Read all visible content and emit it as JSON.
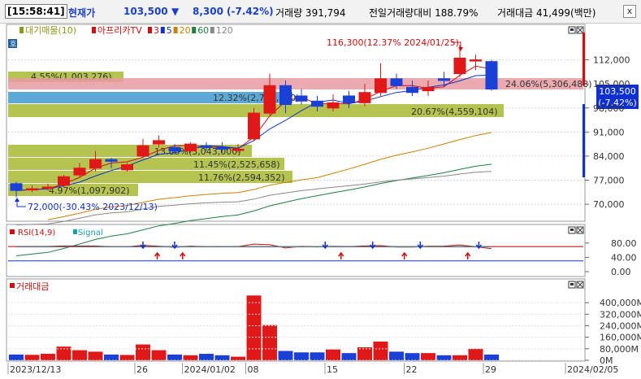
{
  "header": {
    "time": "[15:58:41]",
    "price_label": "현재가",
    "price": "103,500",
    "change_arrow": "▼",
    "change": "8,300",
    "change_pct": "(-7.42%)",
    "volume_text": "거래량 391,794",
    "prev_ratio_text": "전일거래량대비 188.79%",
    "amount_text": "거래대금 41,499(백만)",
    "close_label": "x"
  },
  "price_panel": {
    "badge": "호",
    "legend": [
      {
        "text": "대기매물(10)",
        "color": "#8a9a1a"
      },
      {
        "text": "아프리카TV",
        "color": "#d01010"
      },
      {
        "text": "3",
        "color": "#d01010"
      },
      {
        "text": "5",
        "color": "#1030d0"
      },
      {
        "text": "20",
        "color": "#d08000"
      },
      {
        "text": "60",
        "color": "#208040"
      },
      {
        "text": "120",
        "color": "#888888"
      }
    ],
    "y_ticks": [
      "112,000",
      "105,000",
      "98,000",
      "91,000",
      "84,000",
      "77,000",
      "70,000"
    ],
    "current_price_box": [
      "103,500",
      "(-7.42%)"
    ],
    "high_annotation": "116,300(12.37% 2024/01/25)",
    "low_annotation": "72,000(-30.43% 2023/12/13)",
    "volume_profile": [
      {
        "label": "4.55%(1,003,276)",
        "color": "#a8b832"
      },
      {
        "label": "24.06%(5,306,488)",
        "color": "#e89aa2"
      },
      {
        "label": "12.32%(2,717,000)",
        "color": "#3f9ad0"
      },
      {
        "label": "20.67%(4,559,104)",
        "color": "#a8b832"
      },
      {
        "label": "13.80%(3,043,000)",
        "color": "#a8b832"
      },
      {
        "label": "11.45%(2,525,658)",
        "color": "#a8b832"
      },
      {
        "label": "11.76%(2,594,352)",
        "color": "#a8b832"
      },
      {
        "label": "4.97%(1,097,902)",
        "color": "#a8b832"
      }
    ]
  },
  "rsi_panel": {
    "legend": [
      "RSI(14,9)",
      "Signal"
    ],
    "y_ticks": [
      "80.00",
      "40.00",
      "0.00"
    ]
  },
  "volume_panel": {
    "legend": "거래대금",
    "y_ticks": [
      "400,000M",
      "320,000M",
      "240,000M",
      "160,000M",
      "80,000M",
      "0M"
    ]
  },
  "x_axis": [
    "2023/12/13",
    "26",
    "2024/01/02",
    "08",
    "15",
    "22",
    "29",
    "2024/02/05"
  ],
  "chart_data": {
    "type": "candlestick",
    "dates": [
      "12/13",
      "12/14",
      "12/15",
      "12/18",
      "12/19",
      "12/20",
      "12/21",
      "12/22",
      "12/26",
      "12/27",
      "12/28",
      "01/02",
      "01/03",
      "01/04",
      "01/05",
      "01/08",
      "01/09",
      "01/10",
      "01/11",
      "01/12",
      "01/15",
      "01/16",
      "01/17",
      "01/18",
      "01/19",
      "01/22",
      "01/23",
      "01/24",
      "01/25",
      "01/26",
      "01/29"
    ],
    "open": [
      76000,
      74500,
      75000,
      75500,
      78500,
      80500,
      83000,
      80000,
      84000,
      87500,
      86500,
      85500,
      87000,
      86500,
      86000,
      89000,
      96500,
      104500,
      101500,
      100000,
      98000,
      101500,
      99500,
      102500,
      106500,
      104000,
      103000,
      106500,
      108000,
      112000,
      111500
    ],
    "close": [
      74000,
      74500,
      75000,
      78000,
      80500,
      83000,
      82500,
      81500,
      87000,
      88500,
      85500,
      87500,
      86500,
      86000,
      86000,
      96500,
      104500,
      99000,
      100000,
      98500,
      99500,
      99500,
      102500,
      106500,
      104500,
      102500,
      104000,
      106000,
      112500,
      112000,
      103500
    ],
    "high": [
      76500,
      75500,
      76000,
      78500,
      82000,
      85500,
      83500,
      82000,
      89000,
      90000,
      87500,
      88000,
      88000,
      88000,
      87500,
      98000,
      108000,
      106000,
      103500,
      101500,
      102000,
      103000,
      105000,
      111000,
      108000,
      106000,
      106000,
      108500,
      116300,
      113500,
      112000
    ],
    "low": [
      72000,
      73500,
      74000,
      75000,
      78000,
      79500,
      80500,
      79500,
      83500,
      86500,
      84500,
      85000,
      85500,
      85000,
      85000,
      88500,
      96000,
      96500,
      99000,
      97000,
      97000,
      98000,
      98500,
      101500,
      103500,
      101500,
      101500,
      104000,
      107000,
      109000,
      103000
    ],
    "trading_value_millions": [
      40000,
      38000,
      45000,
      95000,
      70000,
      60000,
      40000,
      37000,
      110000,
      70000,
      40000,
      35000,
      45000,
      35000,
      25000,
      450000,
      245000,
      65000,
      55000,
      55000,
      75000,
      50000,
      90000,
      130000,
      60000,
      50000,
      50000,
      35000,
      35000,
      80000,
      40000
    ],
    "ma_series": [
      "3",
      "5",
      "20",
      "60",
      "120"
    ],
    "y_range": [
      66000,
      119000
    ],
    "rsi_range": [
      0,
      100
    ],
    "volume_range": [
      0,
      480000
    ]
  }
}
